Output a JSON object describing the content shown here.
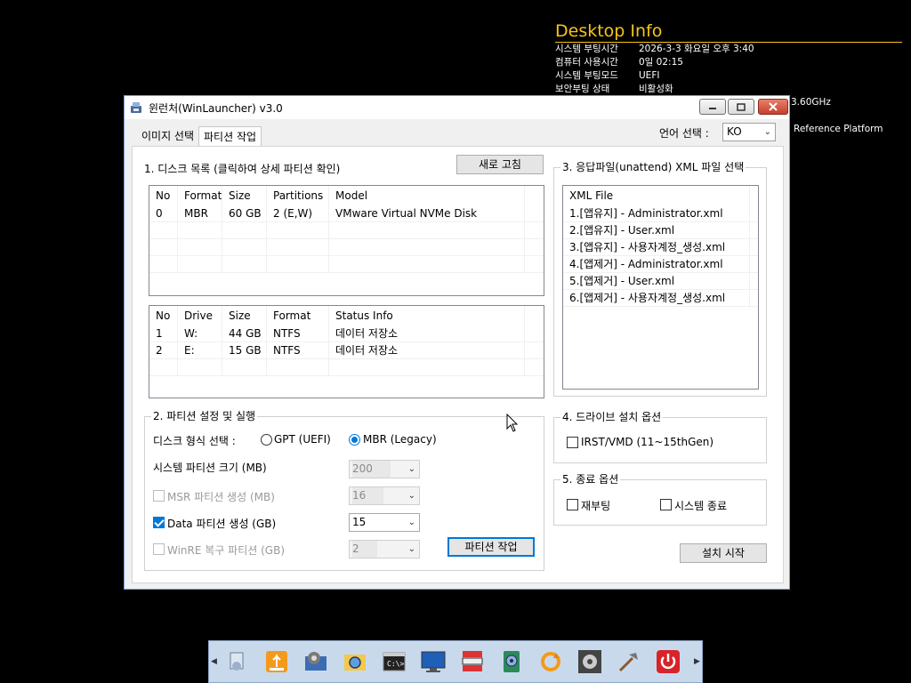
{
  "desktop_info": {
    "title": "Desktop Info",
    "rows": [
      {
        "key": "시스템 부팅시간",
        "value": "2026-3-3 화요일 오후 3:40"
      },
      {
        "key": "컴퓨터 사용시간",
        "value": "0일 02:15"
      },
      {
        "key": "시스템 부팅모드",
        "value": "UEFI"
      },
      {
        "key": "보안부팅 상태",
        "value": "비활성화"
      }
    ],
    "cpu_fragment": "3.60GHz",
    "board_fragment": "Reference Platform"
  },
  "window": {
    "title": "윈런처(WinLauncher) v3.0",
    "tabs": [
      {
        "label": "이미지 선택",
        "active": false
      },
      {
        "label": "파티션 작업",
        "active": true
      }
    ],
    "language": {
      "label": "언어 선택 :",
      "value": "KO"
    }
  },
  "disk_section": {
    "title": "1. 디스크 목록 (클릭하여 상세 파티션 확인)",
    "refresh_label": "새로 고침",
    "disk_table": {
      "columns": [
        "No",
        "Format",
        "Size",
        "Partitions",
        "Model"
      ],
      "rows": [
        [
          "0",
          "MBR",
          "60 GB",
          "2 (E,W)",
          "VMware Virtual NVMe Disk"
        ]
      ]
    },
    "partition_table": {
      "columns": [
        "No",
        "Drive",
        "Size",
        "Format",
        "Status Info"
      ],
      "rows": [
        [
          "1",
          "W:",
          "44 GB",
          "NTFS",
          "데이터 저장소"
        ],
        [
          "2",
          "E:",
          "15 GB",
          "NTFS",
          "데이터 저장소"
        ]
      ]
    }
  },
  "partition_settings": {
    "title": "2. 파티션 설정 및 실행",
    "disk_format_label": "디스크 형식 선택 :",
    "gpt_label": "GPT (UEFI)",
    "mbr_label": "MBR (Legacy)",
    "system_size_label": "시스템 파티션 크기 (MB)",
    "system_size_value": "200",
    "msr_label": "MSR 파티션 생성 (MB)",
    "msr_value": "16",
    "data_label": "Data 파티션 생성 (GB)",
    "data_value": "15",
    "winre_label": "WinRE 복구 파티션 (GB)",
    "winre_value": "2",
    "run_label": "파티션 작업"
  },
  "xml_section": {
    "title": "3. 응답파일(unattend) XML 파일 선택",
    "header": "XML File",
    "items": [
      "1.[앱유지] - Administrator.xml",
      "2.[앱유지] - User.xml",
      "3.[앱유지] - 사용자계정_생성.xml",
      "4.[앱제거] - Administrator.xml",
      "5.[앱제거] - User.xml",
      "6.[앱제거] - 사용자계정_생성.xml"
    ]
  },
  "driver_section": {
    "title": "4. 드라이브 설치 옵션",
    "irst_label": "IRST/VMD (11~15thGen)"
  },
  "exit_section": {
    "title": "5. 종료 옵션",
    "reboot_label": "재부팅",
    "shutdown_label": "시스템 종료"
  },
  "install_label": "설치 시작",
  "taskbar_icons": [
    "program-icon",
    "usb-drive-icon",
    "settings-window-icon",
    "folder-search-icon",
    "command-prompt-icon",
    "monitor-icon",
    "partition-icon",
    "disk-tool-icon",
    "refresh-icon",
    "gear-icon",
    "tools-icon",
    "power-icon"
  ]
}
